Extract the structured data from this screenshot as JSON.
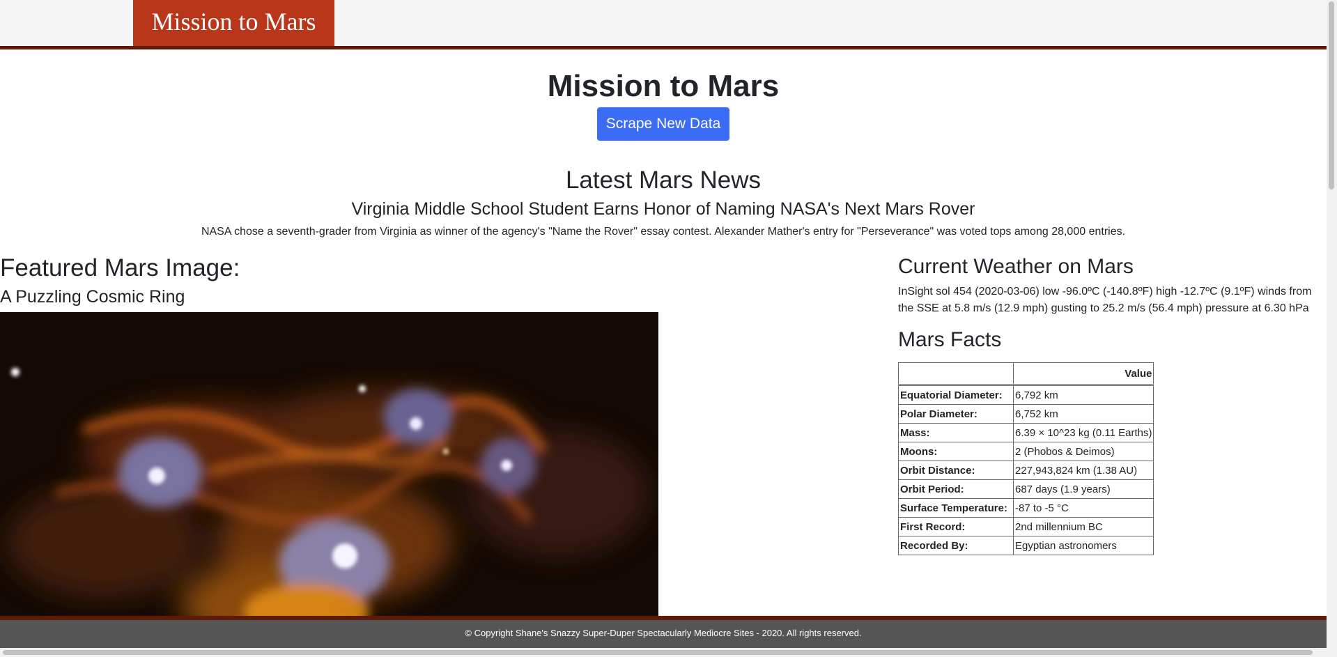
{
  "navbar": {
    "brand": "Mission to Mars"
  },
  "header": {
    "title": "Mission to Mars",
    "scrape_button": "Scrape New Data"
  },
  "news": {
    "heading": "Latest Mars News",
    "title": "Virginia Middle School Student Earns Honor of Naming NASA's Next Mars Rover",
    "paragraph": "NASA chose a seventh-grader from Virginia as winner of the agency's \"Name the Rover\" essay contest. Alexander Mather's entry for \"Perseverance\" was voted tops among 28,000 entries."
  },
  "featured": {
    "heading": "Featured Mars Image:",
    "title": "A Puzzling Cosmic Ring"
  },
  "weather": {
    "heading": "Current Weather on Mars",
    "text": "InSight sol 454 (2020-03-06) low -96.0ºC (-140.8ºF) high -12.7ºC (9.1ºF) winds from the SSE at 5.8 m/s (12.9 mph) gusting to 25.2 m/s (56.4 mph) pressure at 6.30 hPa"
  },
  "facts": {
    "heading": "Mars Facts",
    "column_header": "Value",
    "rows": [
      {
        "label": "Equatorial Diameter:",
        "value": "6,792 km"
      },
      {
        "label": "Polar Diameter:",
        "value": "6,752 km"
      },
      {
        "label": "Mass:",
        "value": "6.39 × 10^23 kg (0.11 Earths)"
      },
      {
        "label": "Moons:",
        "value": "2 (Phobos & Deimos)"
      },
      {
        "label": "Orbit Distance:",
        "value": "227,943,824 km (1.38 AU)"
      },
      {
        "label": "Orbit Period:",
        "value": "687 days (1.9 years)"
      },
      {
        "label": "Surface Temperature:",
        "value": "-87 to -5 °C"
      },
      {
        "label": "First Record:",
        "value": "2nd millennium BC"
      },
      {
        "label": "Recorded By:",
        "value": "Egyptian astronomers"
      }
    ]
  },
  "footer": {
    "text": "© Copyright Shane's Snazzy Super-Duper Spectacularly Mediocre Sites - 2020. All rights reserved."
  },
  "colors": {
    "brand": "#b9361a",
    "accent_border": "#5c1a08",
    "button": "#3b6cf5",
    "footer_bg": "#555555"
  }
}
